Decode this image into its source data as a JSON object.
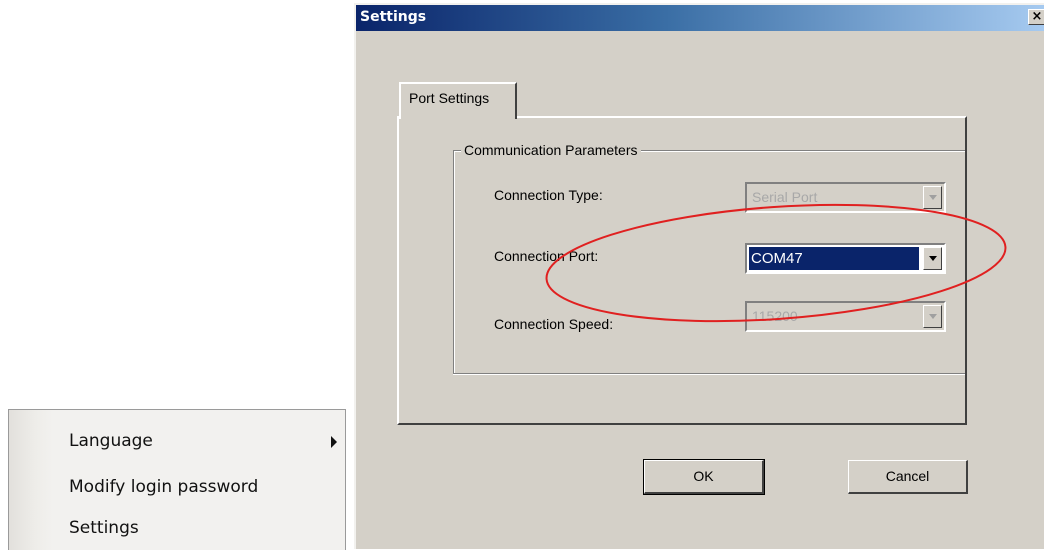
{
  "context_menu": {
    "items": [
      {
        "label": "Language",
        "has_submenu": true
      },
      {
        "label": "Modify login password"
      },
      {
        "label": "Settings"
      }
    ]
  },
  "dialog": {
    "title": "Settings",
    "close_glyph": "×",
    "tab": {
      "label": "Port Settings"
    },
    "group": {
      "label": "Communication Parameters"
    },
    "fields": {
      "connection_type": {
        "label": "Connection Type:",
        "value": "Serial Port",
        "enabled": false
      },
      "connection_port": {
        "label": "Connection Port:",
        "value": "COM47",
        "enabled": true,
        "selected": true
      },
      "connection_speed": {
        "label": "Connection Speed:",
        "value": "115200",
        "enabled": false
      }
    },
    "buttons": {
      "ok": "OK",
      "cancel": "Cancel"
    }
  },
  "annotation": {
    "shape": "ellipse",
    "color": "#e02020",
    "highlights": "connection_port"
  },
  "colors": {
    "dialog_bg": "#d4d0c8",
    "title_start": "#0a246a",
    "title_end": "#a6caf0",
    "selection": "#0a246a"
  }
}
